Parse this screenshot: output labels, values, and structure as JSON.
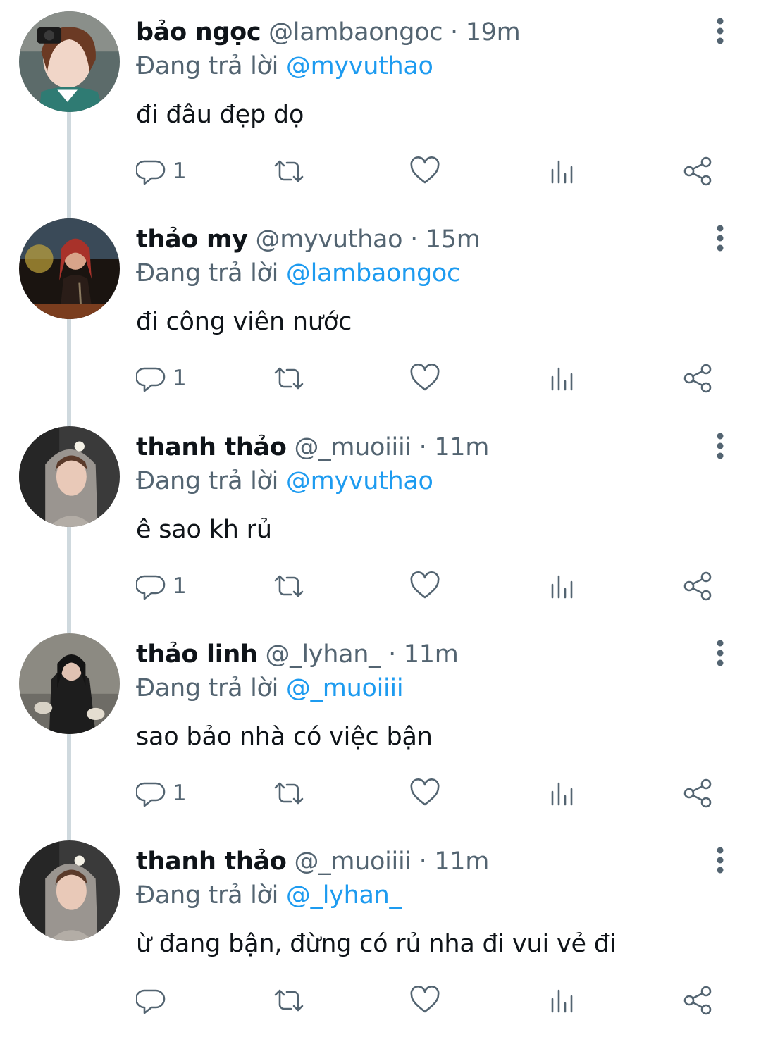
{
  "colors": {
    "name": "#0f1419",
    "meta": "#536471",
    "mention": "#1d9bf0",
    "thread_line": "#cfd9de",
    "background": "#ffffff"
  },
  "icons": {
    "reply": "speech-bubble-icon",
    "retweet": "retweet-arrows-icon",
    "like": "heart-icon",
    "views": "bar-chart-icon",
    "share": "share-nodes-icon",
    "more": "vertical-ellipsis-icon"
  },
  "replying_prefix": "Đang trả lời",
  "tweets": [
    {
      "name": "bảo ngọc",
      "handle": "@lambaongoc",
      "time": "19m",
      "reply_to": "@myvuthao",
      "text": "đi đâu đẹp dọ",
      "reply_count": "1"
    },
    {
      "name": "thảo my",
      "handle": "@myvuthao",
      "time": "15m",
      "reply_to": "@lambaongoc",
      "text": "đi công viên nước",
      "reply_count": "1"
    },
    {
      "name": "thanh thảo",
      "handle": "@_muoiiii",
      "time": "11m",
      "reply_to": "@myvuthao",
      "text": "ê sao kh rủ",
      "reply_count": "1"
    },
    {
      "name": "thảo linh",
      "handle": "@_lyhan_",
      "time": "11m",
      "reply_to": "@_muoiiii",
      "text": "sao bảo nhà có việc bận",
      "reply_count": "1"
    },
    {
      "name": "thanh thảo",
      "handle": "@_muoiiii",
      "time": "11m",
      "reply_to": "@_lyhan_",
      "text": "ừ đang bận, đừng có rủ nha đi vui vẻ đi",
      "reply_count": ""
    }
  ]
}
